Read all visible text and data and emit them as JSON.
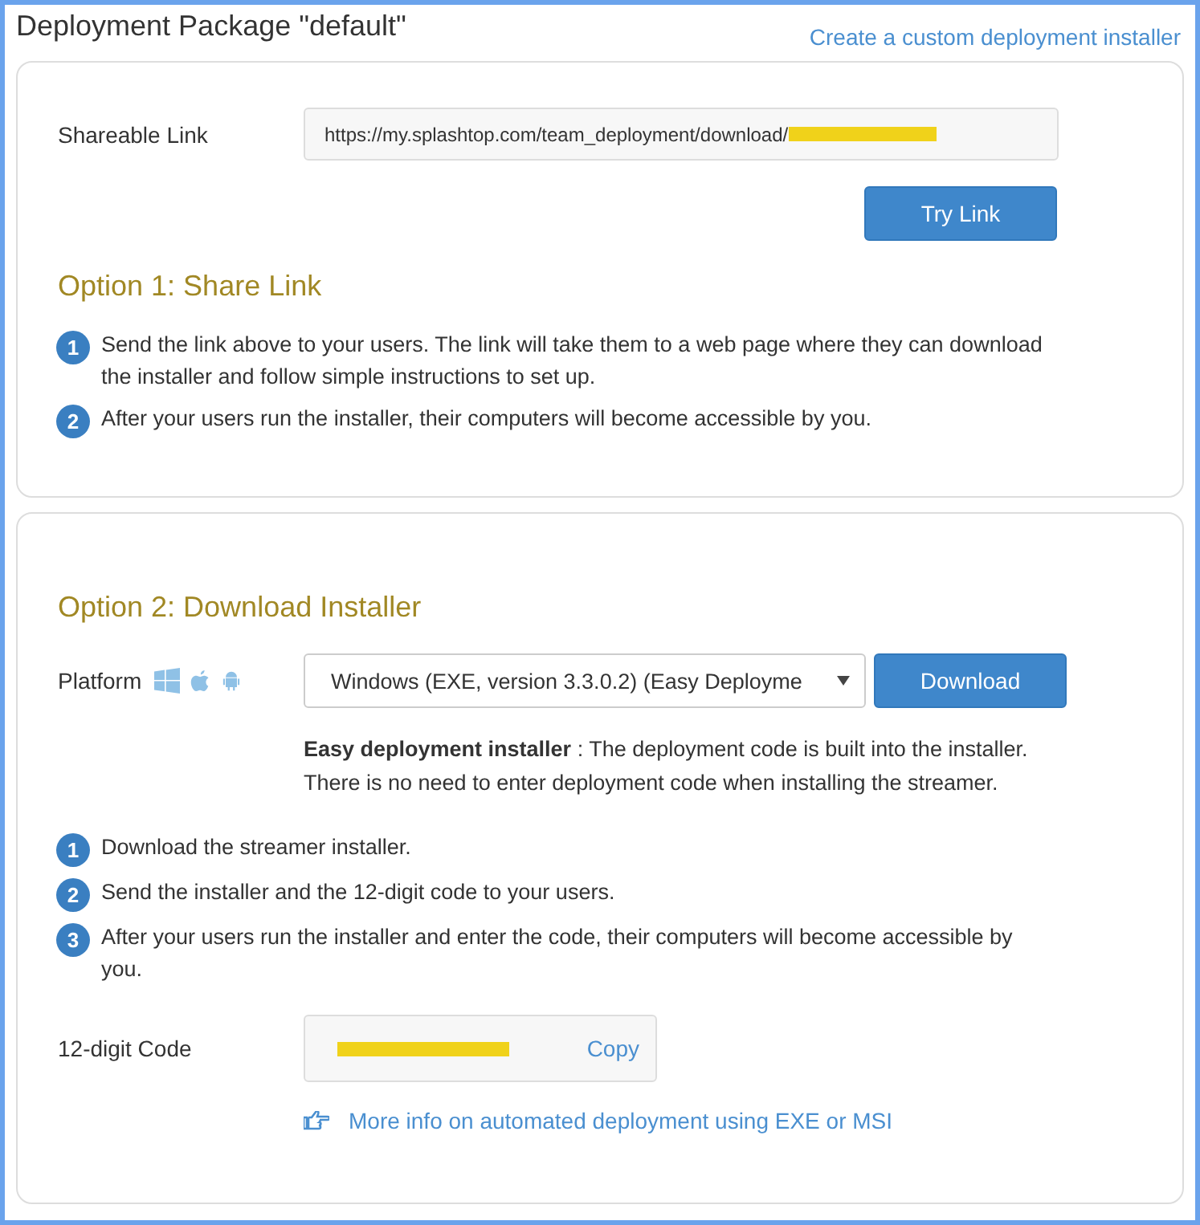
{
  "header": {
    "title": "Deployment Package \"default\"",
    "link": "Create a custom deployment installer"
  },
  "option1": {
    "link_label": "Shareable Link",
    "link_value": "https://my.splashtop.com/team_deployment/download/",
    "try_button": "Try Link",
    "heading": "Option 1: Share Link",
    "steps": [
      {
        "number": "1",
        "text": "Send the link above to your users. The link will take them to a web page where they can download the installer and follow simple instructions to set up."
      },
      {
        "number": "2",
        "text": "After your users run the installer, their computers will become accessible by you."
      }
    ]
  },
  "option2": {
    "heading": "Option 2: Download Installer",
    "platform_label": "Platform",
    "platform_select": "Windows (EXE, version 3.3.0.2) (Easy Deployme",
    "download_button": "Download",
    "note": "**Easy deployment installer** : The deployment code is built into the installer. There is no need to enter deployment code when installing the streamer.",
    "steps": [
      {
        "number": "1",
        "text": "Download the streamer installer."
      },
      {
        "number": "2",
        "text": "Send the installer and the 12-digit code to your users."
      },
      {
        "number": "3",
        "text": "After your users run the installer and enter the code, their computers will become accessible by you."
      }
    ],
    "code_label": "12-digit Code",
    "copy_button": "Copy",
    "more_info": "More info on automated deployment using EXE or MSI"
  }
}
